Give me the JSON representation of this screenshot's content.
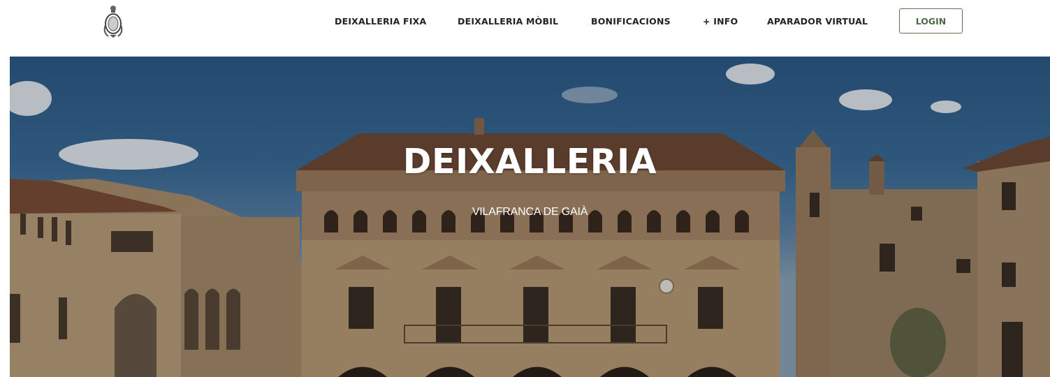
{
  "header": {
    "logo_icon": "coat-of-arms-icon",
    "nav": [
      {
        "label": "DEIXALLERIA FIXA"
      },
      {
        "label": "DEIXALLERIA MÒBIL"
      },
      {
        "label": "BONIFICACIONS"
      },
      {
        "label": "+ INFO"
      },
      {
        "label": "APARADOR VIRTUAL"
      }
    ],
    "login_label": "LOGIN"
  },
  "hero": {
    "title": "DEIXALLERIA",
    "subtitle": "VILAFRANCA DE GAIÀ"
  },
  "colors": {
    "login_border": "#5a7350",
    "sky": "#2c5a87",
    "stone": "#b89a76"
  }
}
